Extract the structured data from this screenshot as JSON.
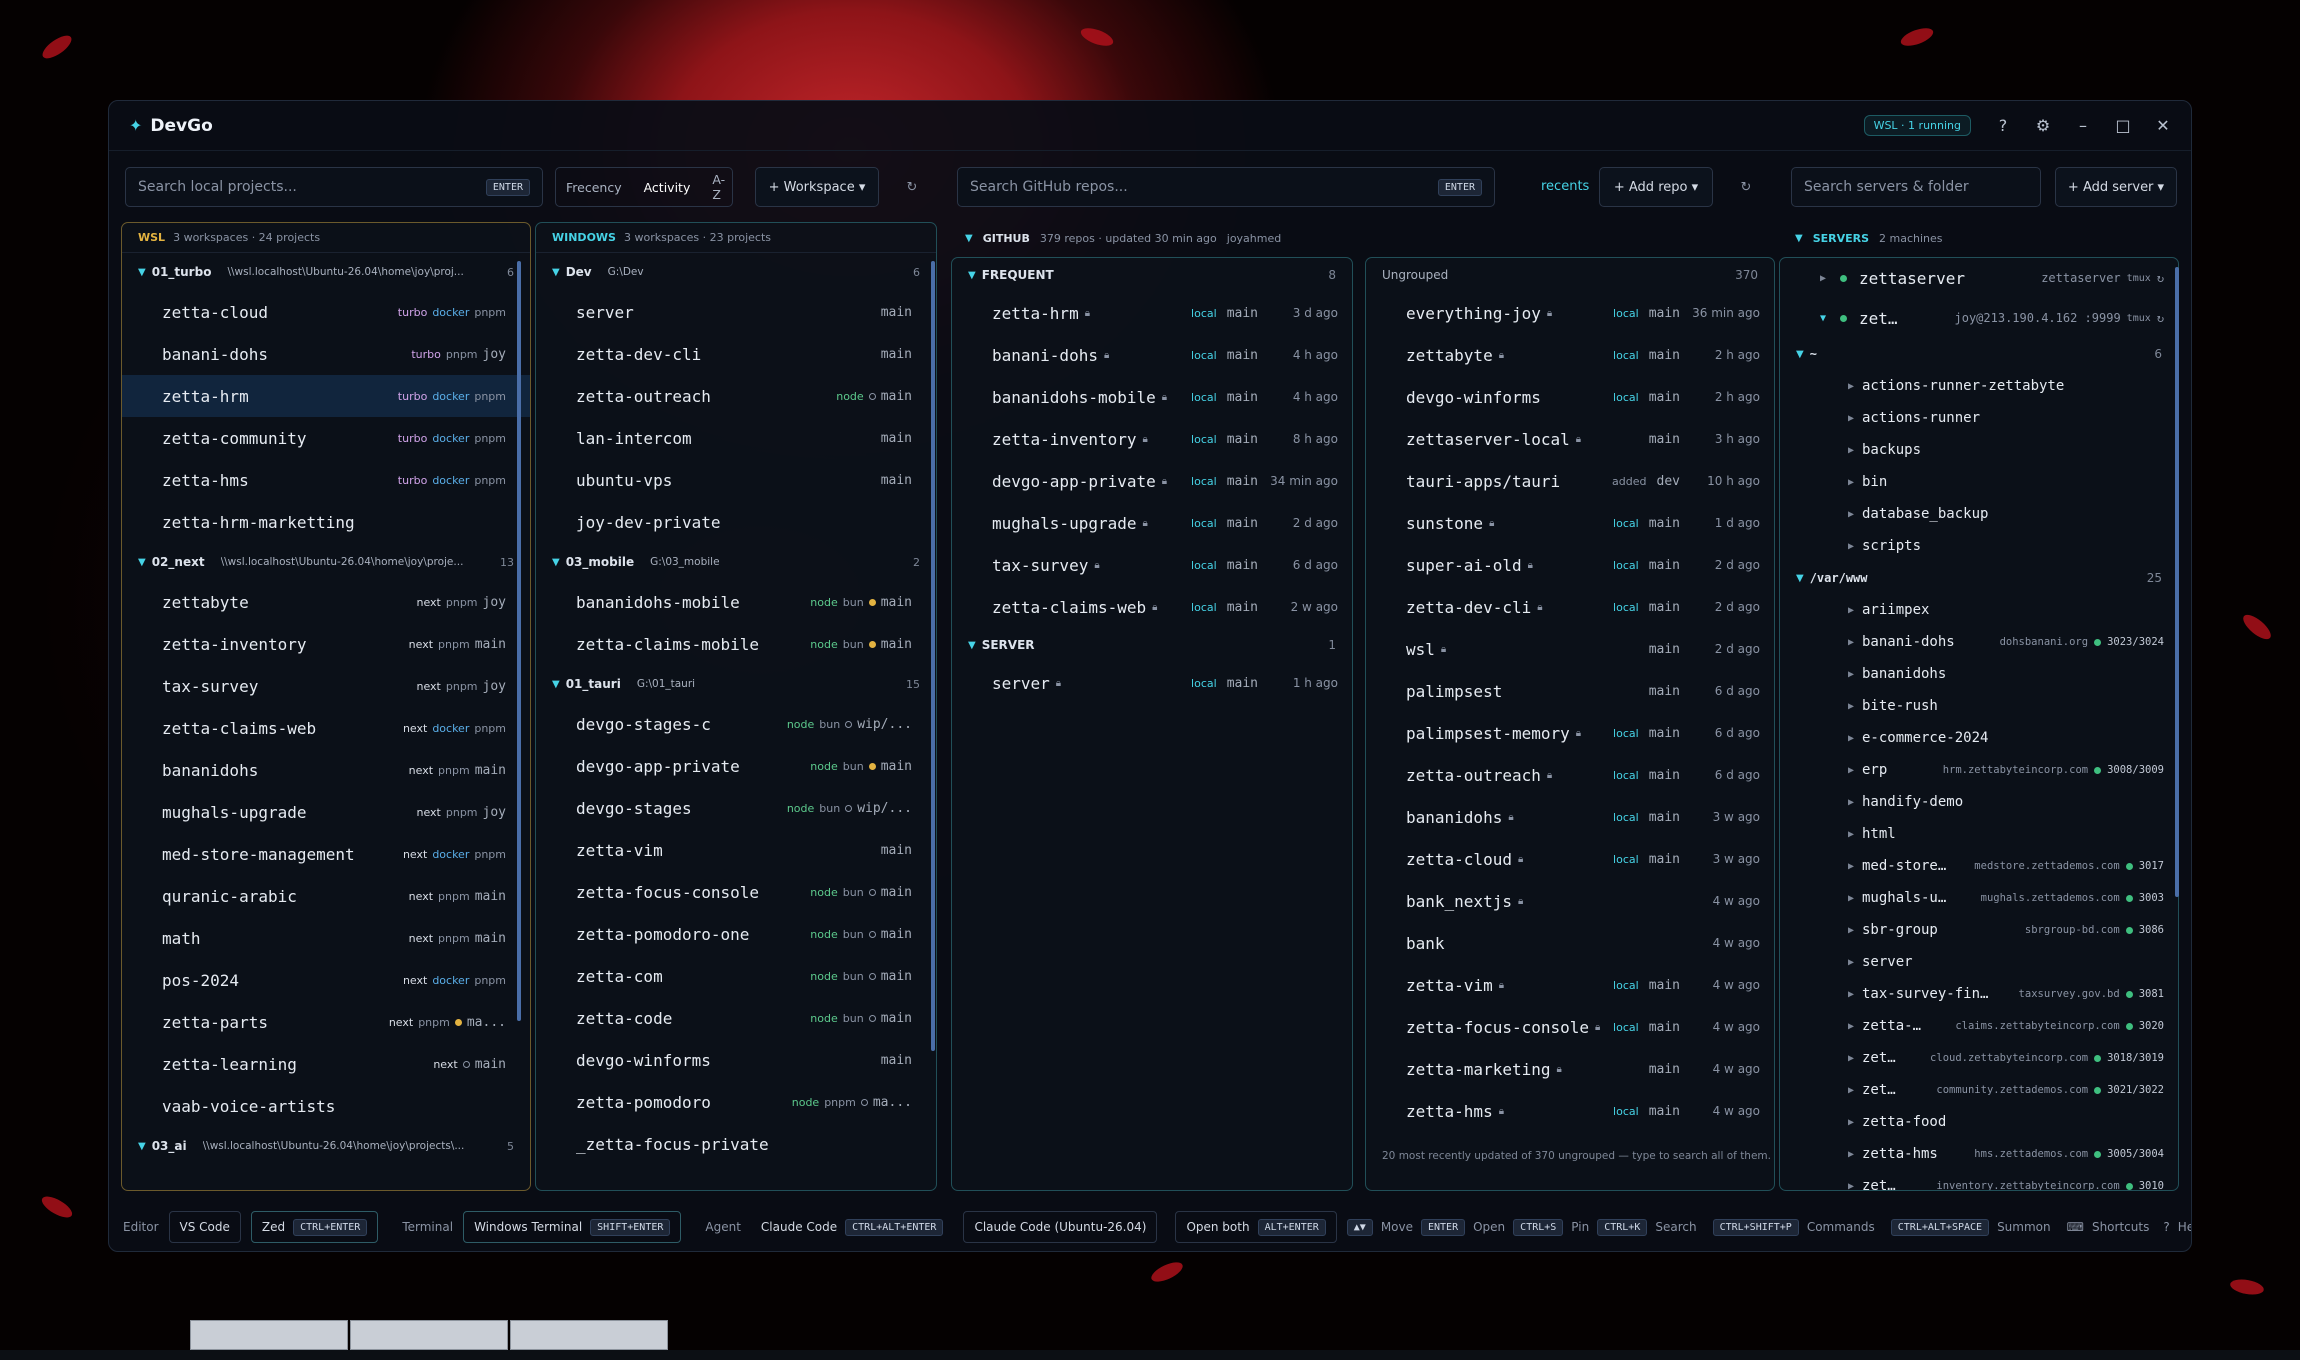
{
  "app": {
    "title": "DevGo",
    "status_pill": "WSL · 1 running",
    "help": "?"
  },
  "top": {
    "local_search_placeholder": "Search local projects...",
    "enter": "ENTER",
    "sort": [
      "Frecency",
      "Activity",
      "A-Z"
    ],
    "workspace_btn": "Workspace",
    "github_search_placeholder": "Search GitHub repos...",
    "recents": "recents",
    "add_repo": "Add repo",
    "servers_search_placeholder": "Search servers & folder",
    "add_server": "Add server"
  },
  "wsl": {
    "label": "WSL",
    "summary": "3 workspaces · 24 projects",
    "groups": [
      {
        "name": "01_turbo",
        "path": "\\\\wsl.localhost\\Ubuntu-26.04\\home\\joy\\proj...",
        "count": "6",
        "items": [
          {
            "name": "zetta-cloud",
            "tags": [
              "turbo",
              "docker",
              "pnpm"
            ]
          },
          {
            "name": "banani-dohs",
            "tags": [
              "turbo",
              "pnpm",
              "joy"
            ]
          },
          {
            "name": "zetta-hrm",
            "tags": [
              "turbo",
              "docker",
              "pnpm"
            ],
            "selected": true
          },
          {
            "name": "zetta-community",
            "tags": [
              "turbo",
              "docker",
              "pnpm"
            ]
          },
          {
            "name": "zetta-hms",
            "tags": [
              "turbo",
              "docker",
              "pnpm"
            ]
          },
          {
            "name": "zetta-hrm-marketting",
            "tags": []
          }
        ]
      },
      {
        "name": "02_next",
        "path": "\\\\wsl.localhost\\Ubuntu-26.04\\home\\joy\\proje...",
        "count": "13",
        "items": [
          {
            "name": "zettabyte",
            "tags": [
              "next",
              "pnpm",
              "joy"
            ]
          },
          {
            "name": "zetta-inventory",
            "tags": [
              "next",
              "pnpm",
              "main"
            ]
          },
          {
            "name": "tax-survey",
            "tags": [
              "next",
              "pnpm",
              "joy"
            ]
          },
          {
            "name": "zetta-claims-web",
            "tags": [
              "next",
              "docker",
              "pnpm"
            ]
          },
          {
            "name": "bananidohs",
            "tags": [
              "next",
              "pnpm",
              "main"
            ]
          },
          {
            "name": "mughals-upgrade",
            "tags": [
              "next",
              "pnpm",
              "joy"
            ]
          },
          {
            "name": "med-store-management",
            "tags": [
              "next",
              "docker",
              "pnpm"
            ]
          },
          {
            "name": "quranic-arabic",
            "tags": [
              "next",
              "pnpm",
              "main"
            ]
          },
          {
            "name": "math",
            "tags": [
              "next",
              "pnpm",
              "main"
            ]
          },
          {
            "name": "pos-2024",
            "tags": [
              "next",
              "docker",
              "pnpm"
            ]
          },
          {
            "name": "zetta-parts",
            "tags": [
              "next",
              "pnpm",
              "ma..."
            ]
          },
          {
            "name": "zetta-learning",
            "tags": [
              "next",
              "main"
            ]
          },
          {
            "name": "vaab-voice-artists",
            "tags": []
          }
        ]
      },
      {
        "name": "03_ai",
        "path": "\\\\wsl.localhost\\Ubuntu-26.04\\home\\joy\\projects\\...",
        "count": "5",
        "items": []
      }
    ]
  },
  "windows": {
    "label": "WINDOWS",
    "summary": "3 workspaces · 23 projects",
    "groups": [
      {
        "name": "Dev",
        "path": "G:\\Dev",
        "count": "6",
        "items": [
          {
            "name": "server",
            "tags": [
              "main"
            ]
          },
          {
            "name": "zetta-dev-cli",
            "tags": [
              "main"
            ]
          },
          {
            "name": "zetta-outreach",
            "tags": [
              "node",
              "main"
            ]
          },
          {
            "name": "lan-intercom",
            "tags": [
              "main"
            ]
          },
          {
            "name": "ubuntu-vps",
            "tags": [
              "main"
            ]
          },
          {
            "name": "joy-dev-private",
            "tags": []
          }
        ]
      },
      {
        "name": "03_mobile",
        "path": "G:\\03_mobile",
        "count": "2",
        "items": [
          {
            "name": "bananidohs-mobile",
            "tags": [
              "node",
              "bun",
              "main"
            ]
          },
          {
            "name": "zetta-claims-mobile",
            "tags": [
              "node",
              "bun",
              "main"
            ]
          }
        ]
      },
      {
        "name": "01_tauri",
        "path": "G:\\01_tauri",
        "count": "15",
        "items": [
          {
            "name": "devgo-stages-c",
            "tags": [
              "node",
              "bun",
              "wip/..."
            ]
          },
          {
            "name": "devgo-app-private",
            "tags": [
              "node",
              "bun",
              "main"
            ]
          },
          {
            "name": "devgo-stages",
            "tags": [
              "node",
              "bun",
              "wip/..."
            ]
          },
          {
            "name": "zetta-vim",
            "tags": [
              "main"
            ]
          },
          {
            "name": "zetta-focus-console",
            "tags": [
              "node",
              "bun",
              "main"
            ]
          },
          {
            "name": "zetta-pomodoro-one",
            "tags": [
              "node",
              "bun",
              "main"
            ]
          },
          {
            "name": "zetta-com",
            "tags": [
              "node",
              "bun",
              "main"
            ]
          },
          {
            "name": "zetta-code",
            "tags": [
              "node",
              "bun",
              "main"
            ]
          },
          {
            "name": "devgo-winforms",
            "tags": [
              "main"
            ]
          },
          {
            "name": "zetta-pomodoro",
            "tags": [
              "node",
              "pnpm",
              "ma..."
            ]
          },
          {
            "name": "_zetta-focus-private",
            "tags": []
          }
        ]
      }
    ]
  },
  "github": {
    "label": "GITHUB",
    "summary": "379 repos · updated 30 min ago",
    "user": "joyahmed",
    "frequent": {
      "label": "FREQUENT",
      "count": "8",
      "items": [
        {
          "name": "zetta-hrm",
          "local": "local",
          "branch": "main",
          "ago": "3 d ago"
        },
        {
          "name": "banani-dohs",
          "local": "local",
          "branch": "main",
          "ago": "4 h ago"
        },
        {
          "name": "bananidohs-mobile",
          "local": "local",
          "branch": "main",
          "ago": "4 h ago"
        },
        {
          "name": "zetta-inventory",
          "local": "local",
          "branch": "main",
          "ago": "8 h ago"
        },
        {
          "name": "devgo-app-private",
          "local": "local",
          "branch": "main",
          "ago": "34 min ago"
        },
        {
          "name": "mughals-upgrade",
          "local": "local",
          "branch": "main",
          "ago": "2 d ago"
        },
        {
          "name": "tax-survey",
          "local": "local",
          "branch": "main",
          "ago": "6 d ago"
        },
        {
          "name": "zetta-claims-web",
          "local": "local",
          "branch": "main",
          "ago": "2 w ago"
        }
      ]
    },
    "server": {
      "label": "SERVER",
      "count": "1",
      "items": [
        {
          "name": "server",
          "local": "local",
          "branch": "main",
          "ago": "1 h ago"
        }
      ]
    },
    "ungrouped": {
      "label": "Ungrouped",
      "count": "370",
      "note": "20 most recently updated of 370 ungrouped — type to search all of them.",
      "items": [
        {
          "name": "everything-joy",
          "local": "local",
          "branch": "main",
          "ago": "36 min ago"
        },
        {
          "name": "zettabyte",
          "local": "local",
          "branch": "main",
          "ago": "2 h ago"
        },
        {
          "name": "devgo-winforms",
          "local": "local",
          "branch": "main",
          "ago": "2 h ago"
        },
        {
          "name": "zettaserver-local",
          "local": "",
          "branch": "main",
          "ago": "3 h ago"
        },
        {
          "name": "tauri-apps/tauri",
          "local": "added",
          "branch": "dev",
          "ago": "10 h ago"
        },
        {
          "name": "sunstone",
          "local": "local",
          "branch": "main",
          "ago": "1 d ago"
        },
        {
          "name": "super-ai-old",
          "local": "local",
          "branch": "main",
          "ago": "2 d ago"
        },
        {
          "name": "zetta-dev-cli",
          "local": "local",
          "branch": "main",
          "ago": "2 d ago"
        },
        {
          "name": "wsl",
          "local": "",
          "branch": "main",
          "ago": "2 d ago"
        },
        {
          "name": "palimpsest",
          "local": "",
          "branch": "main",
          "ago": "6 d ago"
        },
        {
          "name": "palimpsest-memory",
          "local": "local",
          "branch": "main",
          "ago": "6 d ago"
        },
        {
          "name": "zetta-outreach",
          "local": "local",
          "branch": "main",
          "ago": "6 d ago"
        },
        {
          "name": "bananidohs",
          "local": "local",
          "branch": "main",
          "ago": "3 w ago"
        },
        {
          "name": "zetta-cloud",
          "local": "local",
          "branch": "main",
          "ago": "3 w ago"
        },
        {
          "name": "bank_nextjs",
          "local": "",
          "branch": "",
          "ago": "4 w ago"
        },
        {
          "name": "bank",
          "local": "",
          "branch": "",
          "ago": "4 w ago"
        },
        {
          "name": "zetta-vim",
          "local": "local",
          "branch": "main",
          "ago": "4 w ago"
        },
        {
          "name": "zetta-focus-console",
          "local": "local",
          "branch": "main",
          "ago": "4 w ago"
        },
        {
          "name": "zetta-marketing",
          "local": "",
          "branch": "main",
          "ago": "4 w ago"
        },
        {
          "name": "zetta-hms",
          "local": "local",
          "branch": "main",
          "ago": "4 w ago"
        }
      ]
    }
  },
  "servers": {
    "label": "SERVERS",
    "summary": "2 machines",
    "machines": [
      {
        "name": "zettaserver",
        "hint": "zettaserver",
        "tmux": "tmux"
      },
      {
        "name": "zet…",
        "hint": "joy@213.190.4.162 :9999",
        "tmux": "tmux"
      }
    ],
    "home": {
      "label": "~",
      "count": "6",
      "items": [
        "actions-runner-zettabyte",
        "actions-runner",
        "backups",
        "bin",
        "database_backup",
        "scripts"
      ]
    },
    "www": {
      "label": "/var/www",
      "count": "25",
      "items": [
        {
          "name": "ariimpex",
          "domain": "",
          "port": ""
        },
        {
          "name": "banani-dohs",
          "domain": "dohsbanani.org",
          "port": "3023/3024"
        },
        {
          "name": "bananidohs",
          "domain": "",
          "port": ""
        },
        {
          "name": "bite-rush",
          "domain": "",
          "port": ""
        },
        {
          "name": "e-commerce-2024",
          "domain": "",
          "port": ""
        },
        {
          "name": "erp",
          "domain": "hrm.zettabyteincorp.com",
          "port": "3008/3009"
        },
        {
          "name": "handify-demo",
          "domain": "",
          "port": ""
        },
        {
          "name": "html",
          "domain": "",
          "port": ""
        },
        {
          "name": "med-store…",
          "domain": "medstore.zettademos.com",
          "port": "3017"
        },
        {
          "name": "mughals-u…",
          "domain": "mughals.zettademos.com",
          "port": "3003"
        },
        {
          "name": "sbr-group",
          "domain": "sbrgroup-bd.com",
          "port": "3086"
        },
        {
          "name": "server",
          "domain": "",
          "port": ""
        },
        {
          "name": "tax-survey-fin…",
          "domain": "taxsurvey.gov.bd",
          "port": "3081"
        },
        {
          "name": "zetta-…",
          "domain": "claims.zettabyteincorp.com",
          "port": "3020"
        },
        {
          "name": "zet…",
          "domain": "cloud.zettabyteincorp.com",
          "port": "3018/3019"
        },
        {
          "name": "zet…",
          "domain": "community.zettademos.com",
          "port": "3021/3022"
        },
        {
          "name": "zetta-food",
          "domain": "",
          "port": ""
        },
        {
          "name": "zetta-hms",
          "domain": "hms.zettademos.com",
          "port": "3005/3004"
        },
        {
          "name": "zet…",
          "domain": "inventory.zettabyteincorp.com",
          "port": "3010"
        }
      ]
    }
  },
  "footer": {
    "editor": "Editor",
    "vscode": "VS Code",
    "zed": "Zed",
    "zed_key": "CTRL+ENTER",
    "terminal": "Terminal",
    "wt": "Windows Terminal",
    "wt_key": "SHIFT+ENTER",
    "agent": "Agent",
    "claude": "Claude Code",
    "claude_key": "CTRL+ALT+ENTER",
    "claude_ubuntu": "Claude Code (Ubuntu-26.04)",
    "open_both": "Open both",
    "open_both_key": "ALT+ENTER",
    "hints": [
      {
        "k": "▲▼",
        "l": "Move"
      },
      {
        "k": "ENTER",
        "l": "Open"
      },
      {
        "k": "CTRL+S",
        "l": "Pin"
      },
      {
        "k": "CTRL+K",
        "l": "Search"
      },
      {
        "k": "CTRL+SHIFT+P",
        "l": "Commands"
      },
      {
        "k": "CTRL+ALT+SPACE",
        "l": "Summon"
      }
    ],
    "shortcuts": "Shortcuts",
    "help": "Help"
  }
}
